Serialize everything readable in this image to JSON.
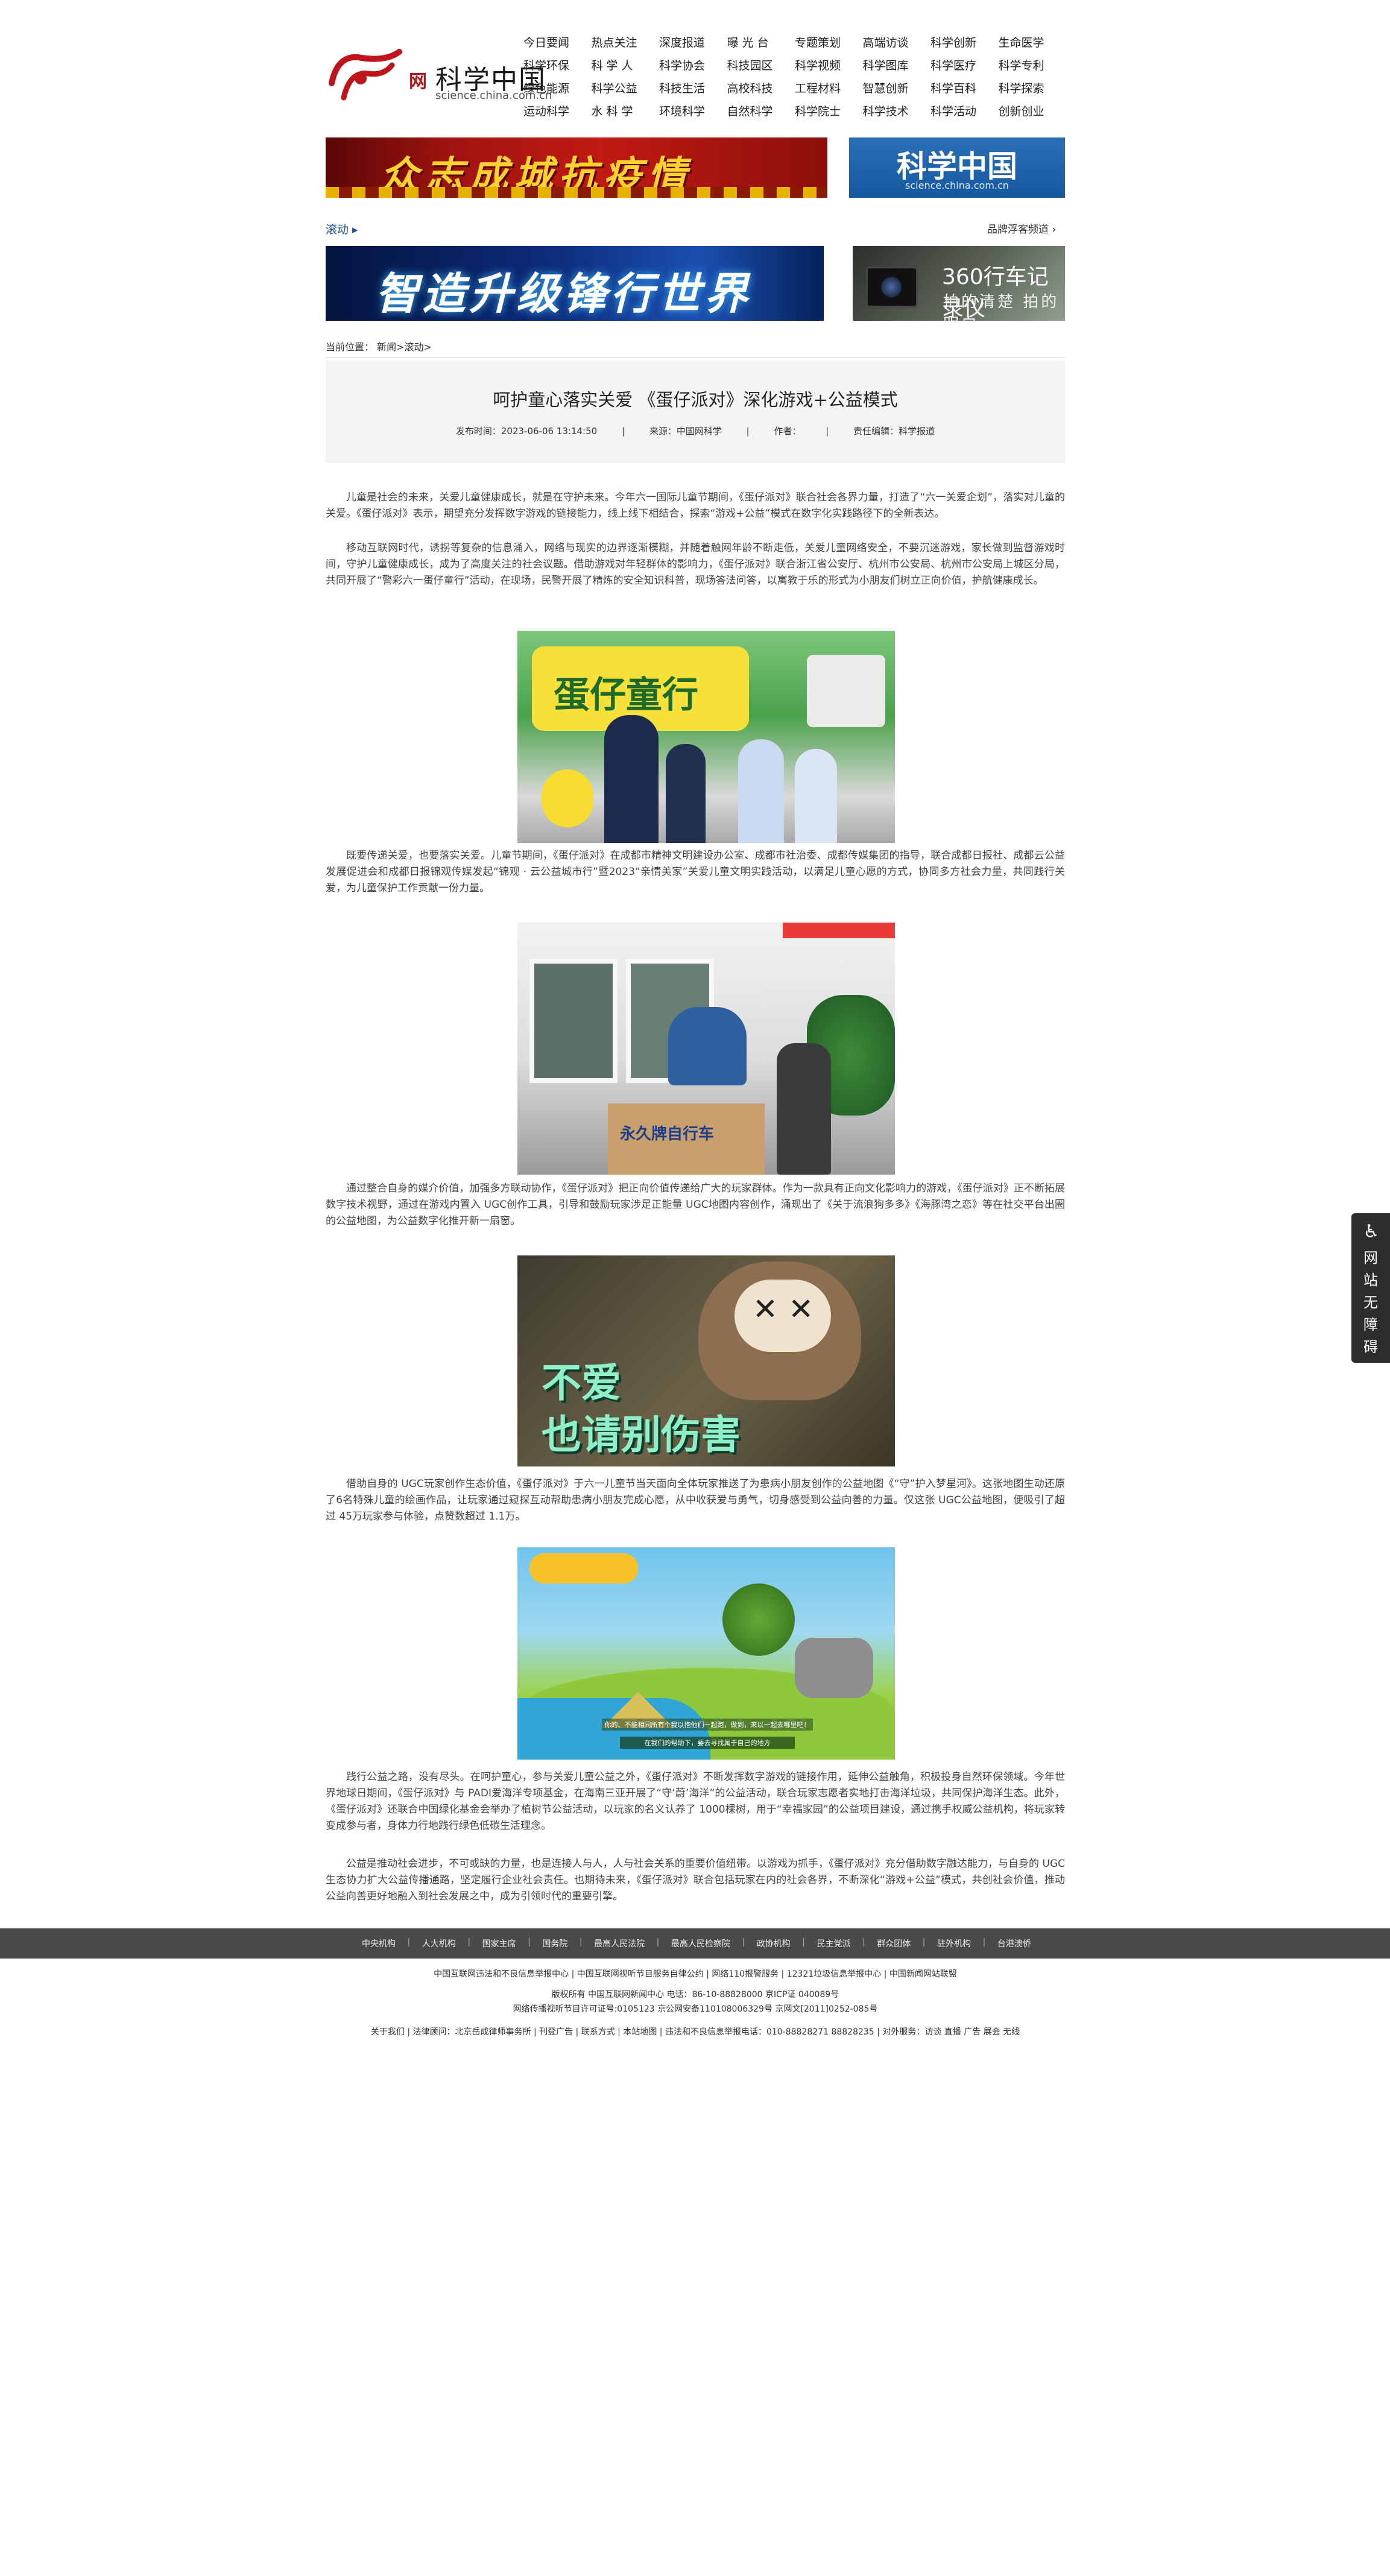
{
  "header": {
    "logo_mark": "中国",
    "logo_net": "网",
    "logo_name": "科学中国",
    "logo_url": "science.china.com.cn",
    "nav": [
      "今日要闻",
      "热点关注",
      "深度报道",
      "曝 光 台",
      "专题策划",
      "高端访谈",
      "科学创新",
      "生命医学",
      "科学环保",
      "科 学 人",
      "科学协会",
      "科技园区",
      "科学视频",
      "科学图库",
      "科学医疗",
      "科学专利",
      "绿色能源",
      "科学公益",
      "科技生活",
      "高校科技",
      "工程材料",
      "智慧创新",
      "科学百科",
      "科学探索",
      "运动科学",
      "水 科 学",
      "环境科学",
      "自然科学",
      "科学院士",
      "科学技术",
      "科学活动",
      "创新创业"
    ]
  },
  "banners": {
    "epidemic": "众志成城抗疫情",
    "logo_title": "科学中国",
    "logo_url": "science.china.com.cn",
    "upgrade": "智造升级锋行世界",
    "recorder_title": "360行车记录仪",
    "recorder_sub": "拍的清楚 拍的明白"
  },
  "rolling": {
    "label": "滚动 ▸",
    "site_link": "品牌浮客频道 ›"
  },
  "breadcrumb": "当前位置： 新闻>滚动>",
  "article": {
    "title": "呵护童心落实关爱 《蛋仔派对》深化游戏+公益模式",
    "publish_time": "发布时间：2023-06-06 13:14:50",
    "source": "来源：中国网科学",
    "author": "作者：",
    "editor": "责任编辑：科学报道",
    "sep": "|",
    "paragraphs": [
      "儿童是社会的未来，关爱儿童健康成长，就是在守护未来。今年六一国际儿童节期间，《蛋仔派对》联合社会各界力量，打造了“六一关爱企划”，落实对儿童的关爱。《蛋仔派对》表示，期望充分发挥数字游戏的链接能力，线上线下相结合，探索“游戏+公益”模式在数字化实践路径下的全新表达。",
      "移动互联网时代，诱拐等复杂的信息涌入，网络与现实的边界逐渐模糊，并随着触网年龄不断走低，关爱儿童网络安全，不要沉迷游戏，家长做到监督游戏时间，守护儿童健康成长，成为了高度关注的社会议题。借助游戏对年轻群体的影响力，《蛋仔派对》联合浙江省公安厅、杭州市公安局、杭州市公安局上城区分局，共同开展了“警彩六一蛋仔童行”活动，在现场，民警开展了精炼的安全知识科普，现场答法问答，以寓教于乐的形式为小朋友们树立正向价值，护航健康成长。",
      "既要传递关爱，也要落实关爱。儿童节期间，《蛋仔派对》在成都市精神文明建设办公室、成都市社治委、成都传媒集团的指导，联合成都日报社、成都云公益发展促进会和成都日报锦观传媒发起“锦观 · 云公益城市行”暨2023“亲情美家”关爱儿童文明实践活动，以满足儿童心愿的方式，协同多方社会力量，共同践行关爱，为儿童保护工作贡献一份力量。",
      "通过整合自身的媒介价值，加强多方联动协作，《蛋仔派对》把正向价值传递给广大的玩家群体。作为一款具有正向文化影响力的游戏，《蛋仔派对》正不断拓展数字技术视野，通过在游戏内置入 UGC创作工具，引导和鼓励玩家涉足正能量 UGC地图内容创作，涌现出了《关于流浪狗多多》《海豚湾之恋》等在社交平台出圈的公益地图，为公益数字化推开新一扇窗。",
      "借助自身的 UGC玩家创作生态价值，《蛋仔派对》于六一儿童节当天面向全体玩家推送了为患病小朋友创作的公益地图《“守”护入梦星河》。这张地图生动还原了6名特殊儿童的绘画作品，让玩家通过窥探互动帮助患病小朋友完成心愿，从中收获爱与勇气，切身感受到公益向善的力量。仅这张 UGC公益地图，便吸引了超过 45万玩家参与体验，点赞数超过 1.1万。",
      "践行公益之路，没有尽头。在呵护童心，参与关爱儿童公益之外，《蛋仔派对》不断发挥数字游戏的链接作用，延伸公益触角，积极投身自然环保领域。今年世界地球日期间，《蛋仔派对》与 PADI爱海洋专项基金，在海南三亚开展了“守‘蔚’海洋”的公益活动，联合玩家志愿者实地打击海洋垃圾，共同保护海洋生态。此外，《蛋仔派对》还联合中国绿化基金会举办了植树节公益活动，以玩家的名义认养了 1000棵树，用于“幸福家园”的公益项目建设，通过携手权威公益机构，将玩家转变成参与者，身体力行地践行绿色低碳生活理念。",
      "公益是推动社会进步，不可或缺的力量，也是连接人与人，人与社会关系的重要价值纽带。以游戏为抓手，《蛋仔派对》充分借助数字融达能力，与自身的 UGC生态协力扩大公益传播通路，坚定履行企业社会责任。也期待未来，《蛋仔派对》联合包括玩家在内的社会各界，不断深化“游戏+公益”模式，共创社会价值，推动公益向善更好地融入到社会发展之中，成为引领时代的重要引擎。"
    ],
    "photo1_sign": "蛋仔童行",
    "photo2_box": "永久牌自行车",
    "photo3_line1": "不爱",
    "photo3_line2": "也请别伤害",
    "photo4_cap1": "你的、不能相同所有个我以抱他们一起跑，做到，来以一起去哪里吧！",
    "photo4_cap2": "在我们的帮助下，要去寻找属于自己的地方"
  },
  "footer": {
    "links": [
      "中央机构",
      "人大机构",
      "国家主席",
      "国务院",
      "最高人民法院",
      "最高人民检察院",
      "政协机构",
      "民主党派",
      "群众团体",
      "驻外机构",
      "台港澳侨"
    ],
    "line1": "中国互联网违法和不良信息举报中心  |  中国互联网视听节目服务自律公约  |  网络110报警服务  |  12321垃圾信息举报中心  |  中国新闻网站联盟",
    "line2": "版权所有 中国互联网新闻中心 电话：86-10-88828000 京ICP证 040089号",
    "line3": "网络传播视听节目许可证号:0105123  京公网安备110108006329号  京网文[2011]0252-085号",
    "line4": "关于我们  |  法律顾问：北京岳成律师事务所  |  刊登广告  |  联系方式  |  本站地图  |  违法和不良信息举报电话：010-88828271 88828235  |  对外服务：访谈  直播  广告  展会  无线"
  },
  "accessibility": {
    "icon": "♿",
    "label": "网站无障碍"
  }
}
